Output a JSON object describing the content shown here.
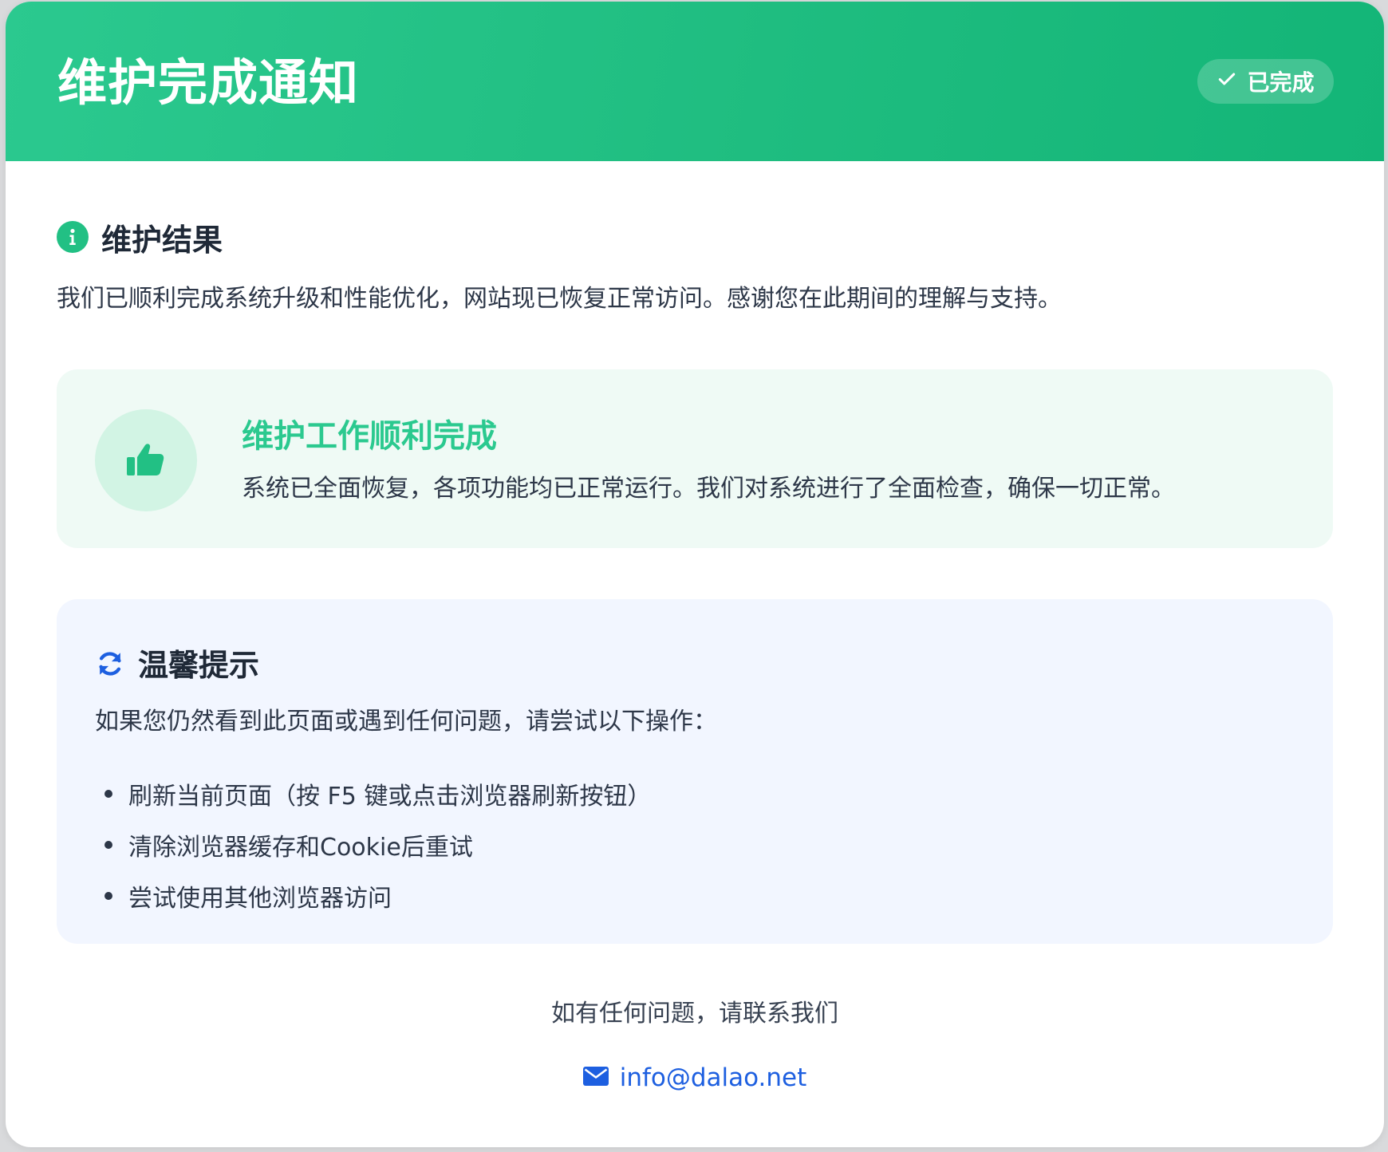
{
  "header": {
    "title": "维护完成通知",
    "badge_label": "已完成",
    "badge_icon": "check-icon"
  },
  "result": {
    "heading": "维护结果",
    "heading_icon": "info-icon",
    "description": "我们已顺利完成系统升级和性能优化，网站现已恢复正常访问。感谢您在此期间的理解与支持。"
  },
  "success": {
    "icon": "thumbs-up-icon",
    "title": "维护工作顺利完成",
    "description": "系统已全面恢复，各项功能均已正常运行。我们对系统进行了全面检查，确保一切正常。"
  },
  "tips": {
    "icon": "refresh-icon",
    "heading": "温馨提示",
    "intro": "如果您仍然看到此页面或遇到任何问题，请尝试以下操作：",
    "items": [
      "刷新当前页面（按 F5 键或点击浏览器刷新按钮）",
      "清除浏览器缓存和Cookie后重试",
      "尝试使用其他浏览器访问"
    ]
  },
  "contact": {
    "text": "如有任何问题，请联系我们",
    "email": "info@dalao.net",
    "email_icon": "envelope-icon"
  },
  "colors": {
    "header_green": "#22c084",
    "success_title": "#2bc98f",
    "success_bg": "#effaf5",
    "tips_bg": "#f2f6ff",
    "link_blue": "#1d5fe0"
  }
}
